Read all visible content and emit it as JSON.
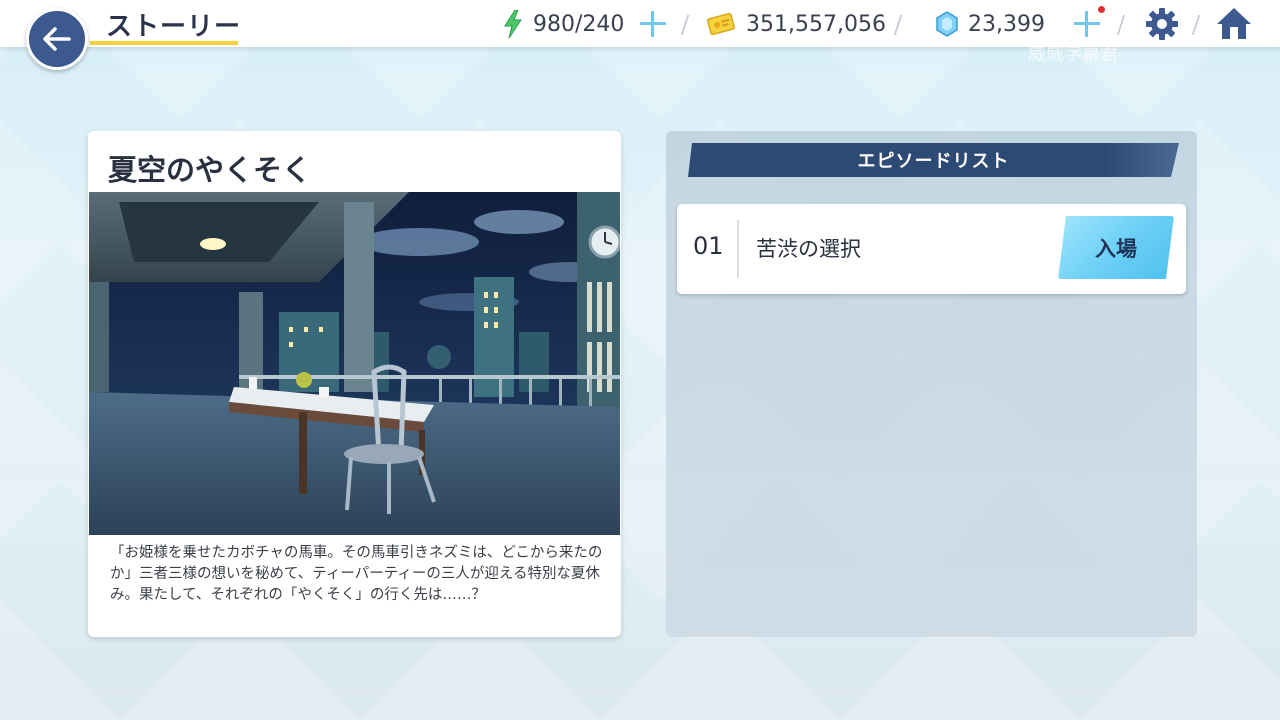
{
  "header": {
    "title": "ストーリー",
    "stamina": "980/240",
    "mana": "351,557,056",
    "jewels": "23,399"
  },
  "story": {
    "title": "夏空のやくそく",
    "description": "「お姫様を乗せたカボチャの馬車。その馬車引きネズミは、どこから来たのか」三者三様の想いを秘めて、ティーパーティーの三人が迎える特別な夏休み。果たして、それぞれの「やくそく」の行く先は……？"
  },
  "episodes": {
    "header": "エピソードリスト",
    "items": [
      {
        "number": "01",
        "title": "苦渋の選択",
        "button": "入場"
      }
    ]
  },
  "watermark": "威威字幕君",
  "colors": {
    "accent_blue": "#3c5a8e",
    "header_navy": "#2d4a74",
    "button_cyan": "#6dd0f6",
    "underline_yellow": "#f2d33a"
  },
  "icons": [
    "back-arrow-icon",
    "lightning-icon",
    "mana-card-icon",
    "jewel-icon",
    "plus-icon",
    "gear-icon",
    "home-icon"
  ]
}
